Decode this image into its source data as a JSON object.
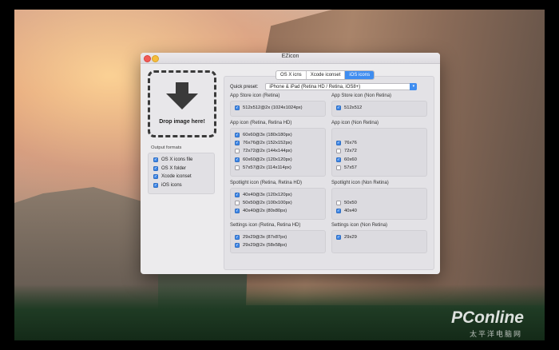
{
  "window": {
    "title": "EZicon"
  },
  "dropzone": {
    "label": "Drop image here!"
  },
  "output_formats": {
    "label": "Output formats",
    "items": [
      {
        "label": "OS X icons file",
        "checked": true
      },
      {
        "label": "OS X folder",
        "checked": true
      },
      {
        "label": "Xcode iconset",
        "checked": true
      },
      {
        "label": "iOS icons",
        "checked": true
      }
    ]
  },
  "tabs": [
    {
      "label": "OS X icns",
      "active": false
    },
    {
      "label": "Xcode iconset",
      "active": false
    },
    {
      "label": "iOS icons",
      "active": true
    }
  ],
  "preset": {
    "label": "Quick preset:",
    "value": "iPhone & iPad (Retina HD / Retina, iOS8+)"
  },
  "sections": {
    "appstore_retina": {
      "title": "App Store icon (Retina)",
      "items": [
        {
          "label": "512x512@2x (1024x1024px)",
          "checked": true
        }
      ]
    },
    "appstore_nonretina": {
      "title": "App Store icon (Non Retina)",
      "items": [
        {
          "label": "512x512",
          "checked": true
        }
      ]
    },
    "app_retina": {
      "title": "App icon (Retina, Retina HD)",
      "items": [
        {
          "label": "60x60@3x (180x180px)",
          "checked": true
        },
        {
          "label": "76x76@2x (152x152px)",
          "checked": true
        },
        {
          "label": "72x72@2x (144x144px)",
          "checked": false
        },
        {
          "label": "60x60@2x (120x120px)",
          "checked": true
        },
        {
          "label": "57x57@2x (114x114px)",
          "checked": false
        }
      ]
    },
    "app_nonretina": {
      "title": "App icon (Non Retina)",
      "items": [
        {
          "label": "76x76",
          "checked": true
        },
        {
          "label": "72x72",
          "checked": false
        },
        {
          "label": "60x60",
          "checked": true
        },
        {
          "label": "57x57",
          "checked": false
        }
      ]
    },
    "spotlight_retina": {
      "title": "Spotlight icon (Retina, Retina HD)",
      "items": [
        {
          "label": "40x40@3x (120x120px)",
          "checked": true
        },
        {
          "label": "50x50@2x (100x100px)",
          "checked": false
        },
        {
          "label": "40x40@2x (80x80px)",
          "checked": true
        }
      ]
    },
    "spotlight_nonretina": {
      "title": "Spotlight icon (Non Retina)",
      "items": [
        {
          "label": "50x50",
          "checked": false
        },
        {
          "label": "40x40",
          "checked": true
        }
      ]
    },
    "settings_retina": {
      "title": "Settings icon (Retina, Retina HD)",
      "items": [
        {
          "label": "29x29@3x (87x87px)",
          "checked": true
        },
        {
          "label": "29x29@2x (58x58px)",
          "checked": true
        }
      ]
    },
    "settings_nonretina": {
      "title": "Settings icon (Non Retina)",
      "items": [
        {
          "label": "29x29",
          "checked": true
        }
      ]
    }
  },
  "watermark": {
    "brand": "PConline",
    "sub": "太平洋电脑网"
  },
  "colors": {
    "accent": "#3f8df0",
    "close": "#f25a55",
    "minimize": "#f6bd3b"
  }
}
